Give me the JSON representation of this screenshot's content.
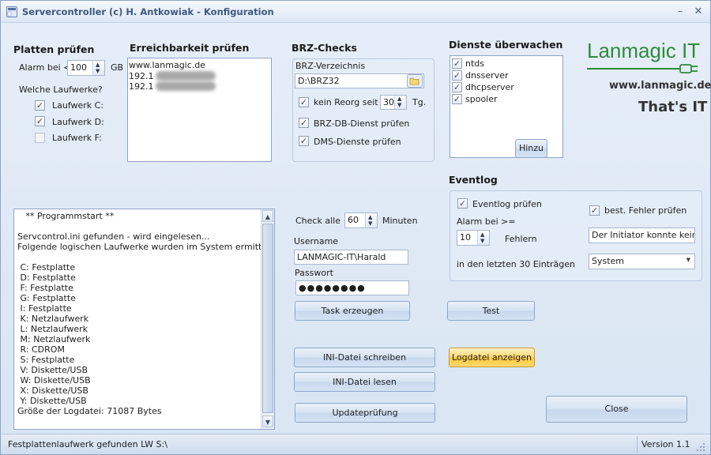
{
  "window": {
    "title": "Servercontroller (c) H. Antkowiak - Konfiguration",
    "minimize": "–",
    "close": "✕"
  },
  "platten": {
    "heading": "Platten prüfen",
    "alarm_label": "Alarm bei <",
    "alarm_value": "100",
    "unit": "GB",
    "question": "Welche Laufwerke?",
    "drives": [
      {
        "label": "Laufwerk C:",
        "checked": true
      },
      {
        "label": "Laufwerk D:",
        "checked": true
      },
      {
        "label": "Laufwerk F:",
        "checked": false
      }
    ]
  },
  "erreichbarkeit": {
    "heading": "Erreichbarkeit prüfen",
    "items": [
      "www.lanmagic.de",
      "192.1",
      "192.1"
    ]
  },
  "brz": {
    "heading": "BRZ-Checks",
    "dir_label": "BRZ-Verzeichnis",
    "dir_value": "D:\\BRZ32",
    "reorg_label": "kein Reorg seit >",
    "reorg_value": "30",
    "reorg_unit": "Tg.",
    "db_dienst_label": "BRZ-DB-Dienst prüfen",
    "dms_label": "DMS-Dienste prüfen"
  },
  "dienste": {
    "heading": "Dienste überwachen",
    "items": [
      "ntds",
      "dnsserver",
      "dhcpserver",
      "spooler"
    ],
    "add_button": "Hinzu"
  },
  "logo": {
    "text": "Lanmagic IT",
    "url": "www.lanmagic.de",
    "slogan": "That's IT",
    "color": "#2e8b3a"
  },
  "eventlog": {
    "heading": "Eventlog",
    "pruefen_label": "Eventlog prüfen",
    "alarm_label": "Alarm bei >=",
    "alarm_value": "10",
    "fehlern_label": "Fehlern",
    "last_label": "in den letzten 30 Einträgen",
    "fehler_label": "best. Fehler prüfen",
    "fehler_value": "Der Initiator konnte keine iS",
    "source_value": "System"
  },
  "log": {
    "lines": [
      "   ** Programmstart **",
      "",
      "Servcontrol.ini gefunden - wird eingelesen...",
      "Folgende logischen Laufwerke wurden im System ermittelt:",
      "",
      " C: Festplatte",
      " D: Festplatte",
      " F: Festplatte",
      " G: Festplatte",
      " I: Festplatte",
      " K: Netzlaufwerk",
      " L: Netzlaufwerk",
      " M: Netzlaufwerk",
      " R: CDROM",
      " S: Festplatte",
      " V: Diskette/USB",
      " W: Diskette/USB",
      " X: Diskette/USB",
      " Y: Diskette/USB",
      "Größe der Logdatei: 71087 Bytes"
    ]
  },
  "check": {
    "label": "Check alle",
    "value": "60",
    "unit": "Minuten"
  },
  "auth": {
    "username_label": "Username",
    "username_value": "LANMAGIC-IT\\Harald",
    "password_label": "Passwort",
    "password_value": "●●●●●●●●"
  },
  "buttons": {
    "task": "Task erzeugen",
    "test": "Test",
    "ini_write": "INI-Datei schreiben",
    "log_show": "Logdatei anzeigen",
    "ini_read": "INI-Datei lesen",
    "update": "Updateprüfung",
    "close": "Close"
  },
  "status": {
    "text": "Festplattenlaufwerk gefunden LW  S:\\",
    "version": "Version 1.1"
  }
}
